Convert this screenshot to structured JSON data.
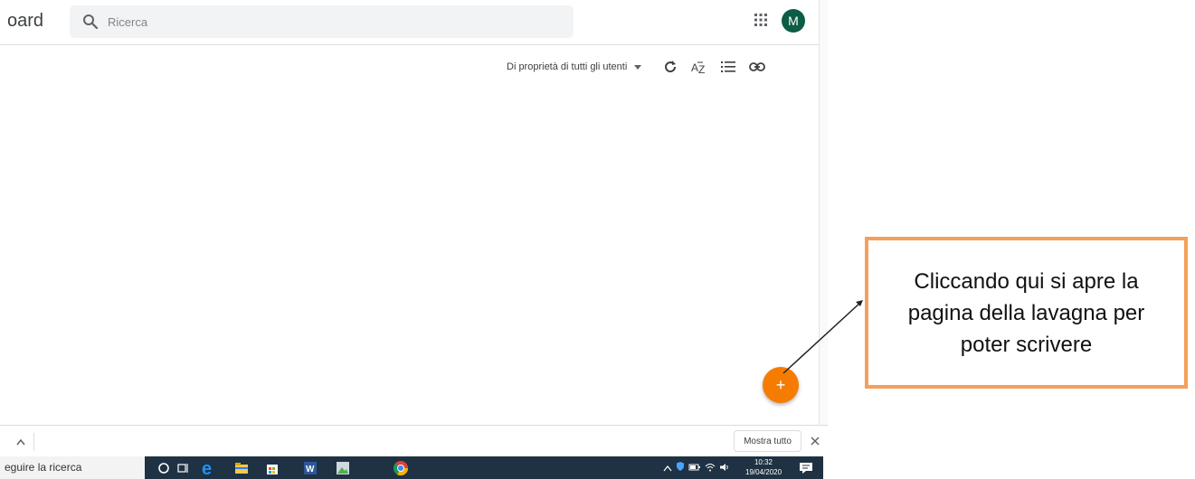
{
  "header": {
    "app_title_fragment": "oard",
    "search_placeholder": "Ricerca",
    "avatar_letter": "M"
  },
  "toolbar": {
    "owner_filter_label": "Di proprietà di tutti gli utenti",
    "icons": [
      "refresh-icon",
      "sort-az-icon",
      "list-view-icon",
      "link-icon"
    ]
  },
  "fab": {
    "label": "+"
  },
  "download_bar": {
    "show_all_label": "Mostra tutto"
  },
  "taskbar": {
    "search_text": "eguire la ricerca",
    "time": "10:32",
    "date": "19/04/2020"
  },
  "annotation": {
    "text": "Cliccando qui si apre la pagina della lavagna per poter scrivere"
  },
  "colors": {
    "fab": "#f57c00",
    "avatar": "#0d5c45",
    "callout_border": "#f4a05a",
    "taskbar": "#1f3243"
  }
}
